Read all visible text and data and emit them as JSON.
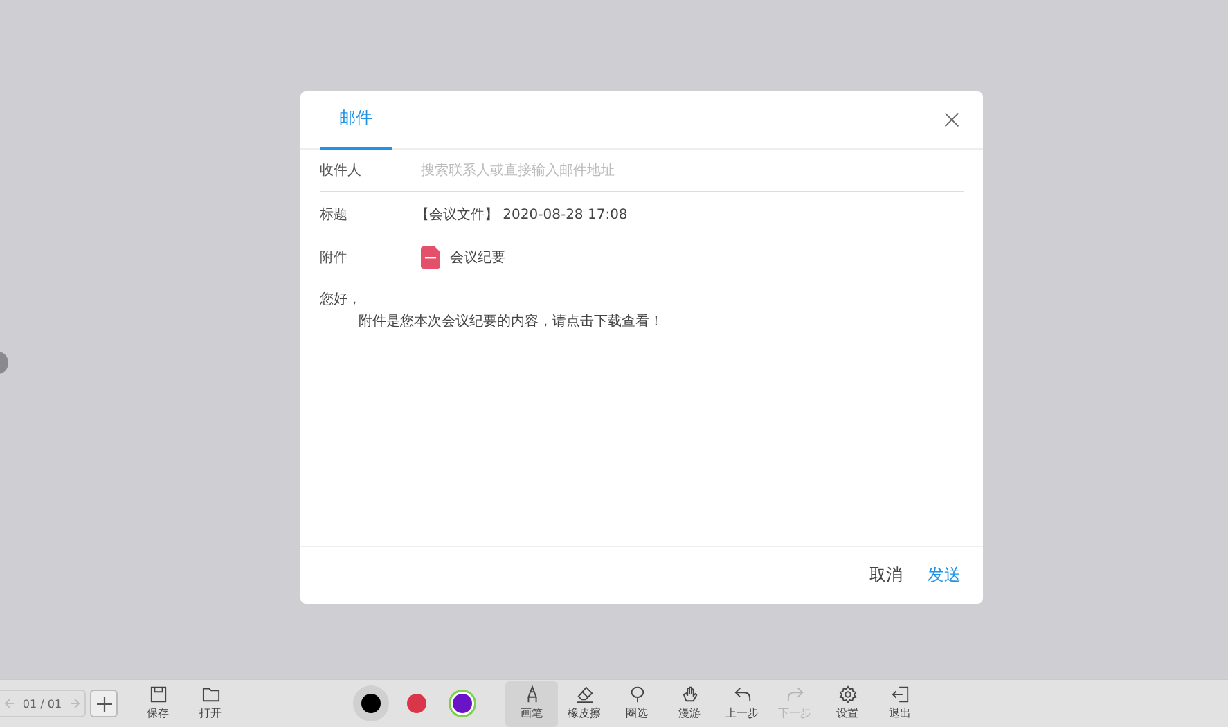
{
  "dialog": {
    "tabs": [
      {
        "label": "邮件",
        "selected": true
      }
    ],
    "fields": [
      {
        "label": "收件人",
        "kind": "input",
        "placeholder": "搜索联系人或直接输入邮件地址"
      },
      {
        "label": "标题",
        "kind": "text",
        "value": "【会议文件】 2020-08-28 17:08"
      },
      {
        "label": "附件",
        "kind": "attachment",
        "value": "会议纪要"
      }
    ],
    "greeting": "您好，",
    "body": "附件是您本次会议纪要的内容，请点击下载查看！",
    "buttons": [
      {
        "label": "取消",
        "kind": "secondary"
      },
      {
        "label": "发送",
        "kind": "primary"
      }
    ]
  },
  "toolbar": {
    "page": "01 / 01",
    "file_tools": [
      {
        "label": "保存"
      },
      {
        "label": "打开"
      }
    ],
    "colors": [
      {
        "color": "#000000",
        "kind": "swatch",
        "selected": true
      },
      {
        "color": "#d9364a",
        "kind": "swatch",
        "selected": false
      },
      {
        "color": "#6a14c8",
        "kind": "custom",
        "selected": false
      }
    ],
    "tools": [
      {
        "label": "画笔",
        "selected": true,
        "disabled": false
      },
      {
        "label": "橡皮擦",
        "selected": false,
        "disabled": false
      },
      {
        "label": "圈选",
        "selected": false,
        "disabled": false
      },
      {
        "label": "漫游",
        "selected": false,
        "disabled": false
      },
      {
        "label": "上一步",
        "selected": false,
        "disabled": false
      },
      {
        "label": "下一步",
        "selected": false,
        "disabled": true
      },
      {
        "label": "设置",
        "selected": false,
        "disabled": false
      },
      {
        "label": "退出",
        "selected": false,
        "disabled": false
      }
    ]
  }
}
